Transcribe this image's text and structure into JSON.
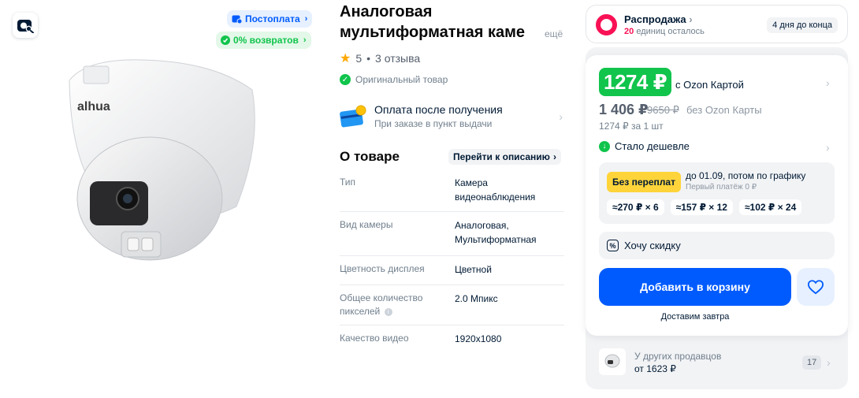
{
  "badges": {
    "postpay": "Постоплата",
    "returns": "0% возвратов"
  },
  "product": {
    "title_line1": "Аналоговая",
    "title_line2": "мультиформатная каме",
    "title_more": "ещё",
    "rating_score": "5",
    "rating_sep": "•",
    "reviews": "3 отзыва",
    "rating_value": 5,
    "original": "Оригинальный товар"
  },
  "payment": {
    "title": "Оплата после получения",
    "subtitle": "При заказе в пункт выдачи"
  },
  "about": {
    "title": "О товаре",
    "link": "Перейти к описанию",
    "specs": [
      {
        "key": "Тип",
        "value_line1": "Камера",
        "value_line2": "видеонаблюдения"
      },
      {
        "key": "Вид камеры",
        "value_line1": "Аналоговая,",
        "value_line2": "Мультиформатная"
      },
      {
        "key": "Цветность дисплея",
        "value_line1": "Цветной",
        "value_line2": ""
      },
      {
        "key_line1": "Общее количество",
        "key_line2": "пикселей",
        "value_line1": "2.0 Мпикс",
        "value_line2": ""
      },
      {
        "key": "Качество видео",
        "value_line1": "1920x1080",
        "value_line2": ""
      }
    ]
  },
  "sale": {
    "title": "Распродажа",
    "units": "20",
    "units_text": "единиц осталось",
    "timer": "4 дня до конца"
  },
  "pricing": {
    "ozon_price": "1274 ₽",
    "ozon_label": "с Ozon Картой",
    "price": "1 406 ₽",
    "old_price": "9650 ₽",
    "price_note": "без Ozon Карты",
    "per_unit": "1274 ₽ за 1 шт",
    "cheaper": "Стало дешевле"
  },
  "installment": {
    "badge": "Без переплат",
    "text": "до 01.09, потом по графику",
    "first_payment": "Первый платёж 0 ₽",
    "options": [
      "≈270 ₽ × 6",
      "≈157 ₽ × 12",
      "≈102 ₽ × 24"
    ]
  },
  "discount": {
    "label": "Хочу скидку"
  },
  "cart": {
    "add_label": "Добавить в корзину",
    "delivery": "Доставим завтра"
  },
  "other_sellers": {
    "title": "У других продавцов",
    "price": "от 1623 ₽",
    "count": "17"
  },
  "colors": {
    "accent_blue": "#005bff",
    "green": "#10c44c",
    "sale_pink": "#f91155",
    "installment_yellow": "#ffd43a"
  }
}
